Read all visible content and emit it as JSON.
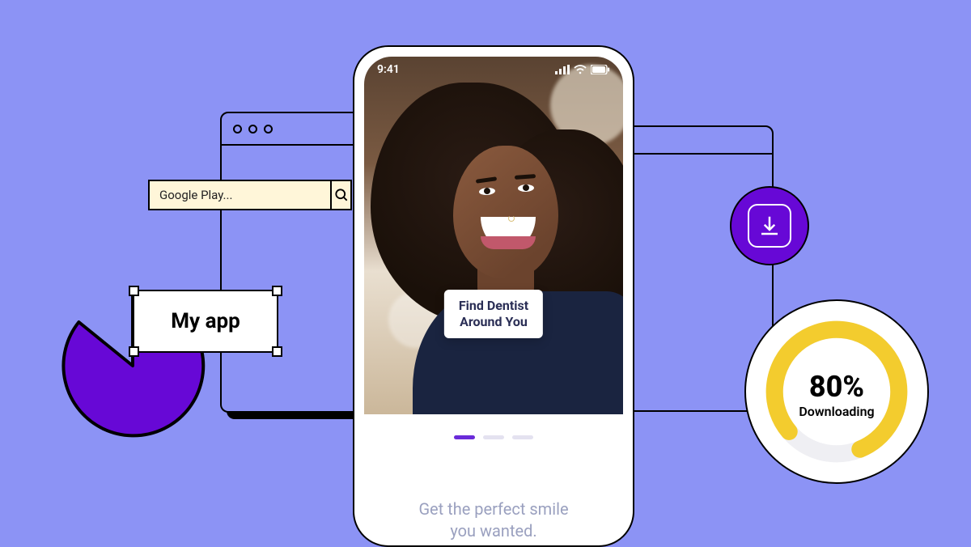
{
  "colors": {
    "bg": "#8c93f5",
    "purple": "#6708d6",
    "accent_yellow": "#f3cc2e",
    "phone_accent": "#6a2bd9"
  },
  "search": {
    "value": "Google Play..."
  },
  "myapp": {
    "label": "My app"
  },
  "phone": {
    "status_time": "9:41",
    "cta_line1": "Find Dentist",
    "cta_line2": "Around You",
    "caption_line1": "Get the perfect smile",
    "caption_line2": "you wanted.",
    "carousel": {
      "total": 3,
      "active_index": 0
    }
  },
  "download": {
    "percent_label": "80%",
    "status_label": "Downloading"
  },
  "chart_data": {
    "type": "pie",
    "title": "",
    "values": [
      75,
      25
    ],
    "categories": [
      "filled",
      "cut"
    ],
    "note": "decorative pac-man style pie, ~75% solid slice",
    "progress_ring": {
      "percent": 80,
      "label": "Downloading"
    }
  }
}
